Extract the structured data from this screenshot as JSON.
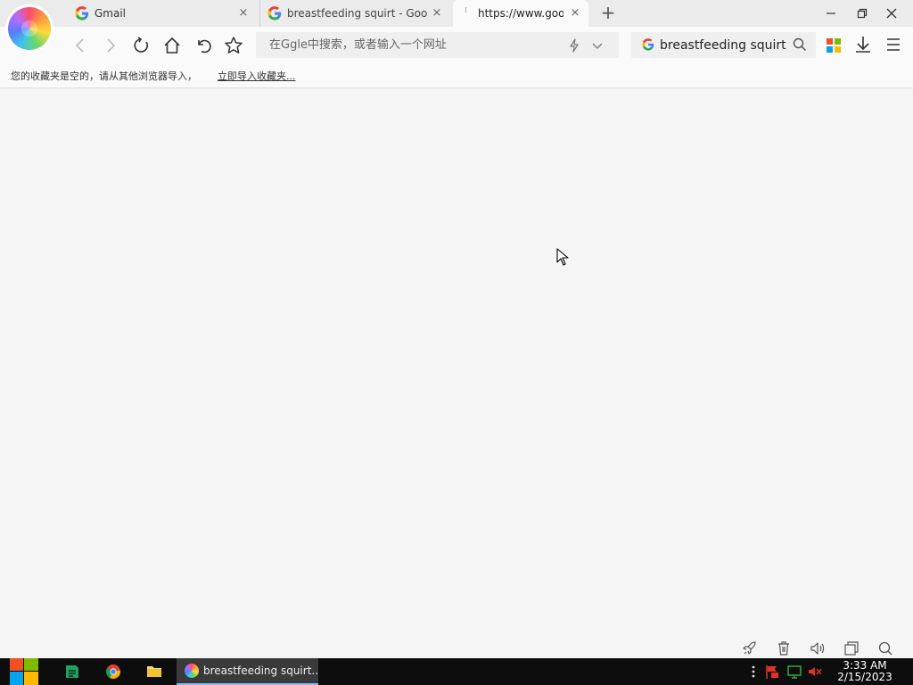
{
  "browser": {
    "tabs": [
      {
        "title": "Gmail",
        "icon": "google-g-icon",
        "active": false
      },
      {
        "title": "breastfeeding squirt - Google",
        "icon": "google-g-icon",
        "active": false
      },
      {
        "title": "https://www.goog",
        "icon": "loading-icon",
        "active": true
      }
    ],
    "tab_close_glyph": "×",
    "new_tab_glyph": "+",
    "address": {
      "value": "",
      "placeholder": "在Ggle中搜索，或者输入一个网址"
    },
    "search": {
      "engine_icon": "google-g-icon",
      "value": "breastfeeding squirt"
    }
  },
  "bookmarks": {
    "empty_message": "您的收藏夹是空的，请从其他浏览器导入，",
    "import_link": "立即导入收藏夹..."
  },
  "statusbar": {
    "icons": [
      "rocket-icon",
      "trash-icon",
      "sound-icon",
      "window-icon",
      "zoom-icon"
    ]
  },
  "taskbar": {
    "active_window": "breastfeeding squirt...",
    "pinned": [
      "sheets-app-icon",
      "chrome-icon",
      "file-explorer-icon"
    ],
    "tray_icons": [
      "more-icon",
      "flag-icon",
      "network-icon",
      "volume-muted-icon"
    ],
    "time": "3:33 AM",
    "date": "2/15/2023"
  },
  "colors": {
    "tab_strip": "#ebebeb",
    "toolbar": "#fafafa",
    "content_bg": "#f5f5f5",
    "taskbar": "#0d0d0d",
    "tray_red": "#e0312b",
    "tray_green": "#2ea84a"
  }
}
